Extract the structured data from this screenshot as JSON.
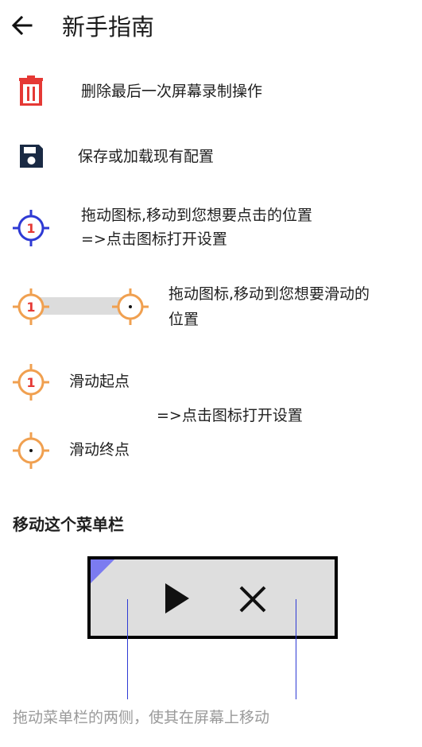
{
  "header": {
    "title": "新手指南",
    "back_icon": "arrow-left-icon"
  },
  "items": [
    {
      "icon": "trash-icon",
      "color": "#E53935",
      "text": "删除最后一次屏幕录制操作"
    },
    {
      "icon": "floppy-disk-icon",
      "color": "#1A2A44",
      "text": "保存或加载现有配置"
    },
    {
      "icon": "crosshair-target-icon",
      "color": "#2E3AD4",
      "badge": "1",
      "text_line1": "拖动图标,移动到您想要点击的位置",
      "text_line2": "=>点击图标打开设置"
    },
    {
      "icon": "swipe-target-icon",
      "color": "#F0A050",
      "badge": "1",
      "text_line1": "拖动图标,移动到您想要滑动的",
      "text_line2": "位置"
    }
  ],
  "swipe": {
    "start_label": "滑动起点",
    "end_label": "滑动终点",
    "open_settings": "=>点击图标打开设置",
    "badge": "1",
    "color": "#F0A050"
  },
  "menu_section": {
    "title": "移动这个菜单栏",
    "play_icon": "play-icon",
    "close_icon": "close-icon",
    "accent": "#7B7BF0",
    "hint": "拖动菜单栏的两侧，使其在屏幕上移动"
  }
}
